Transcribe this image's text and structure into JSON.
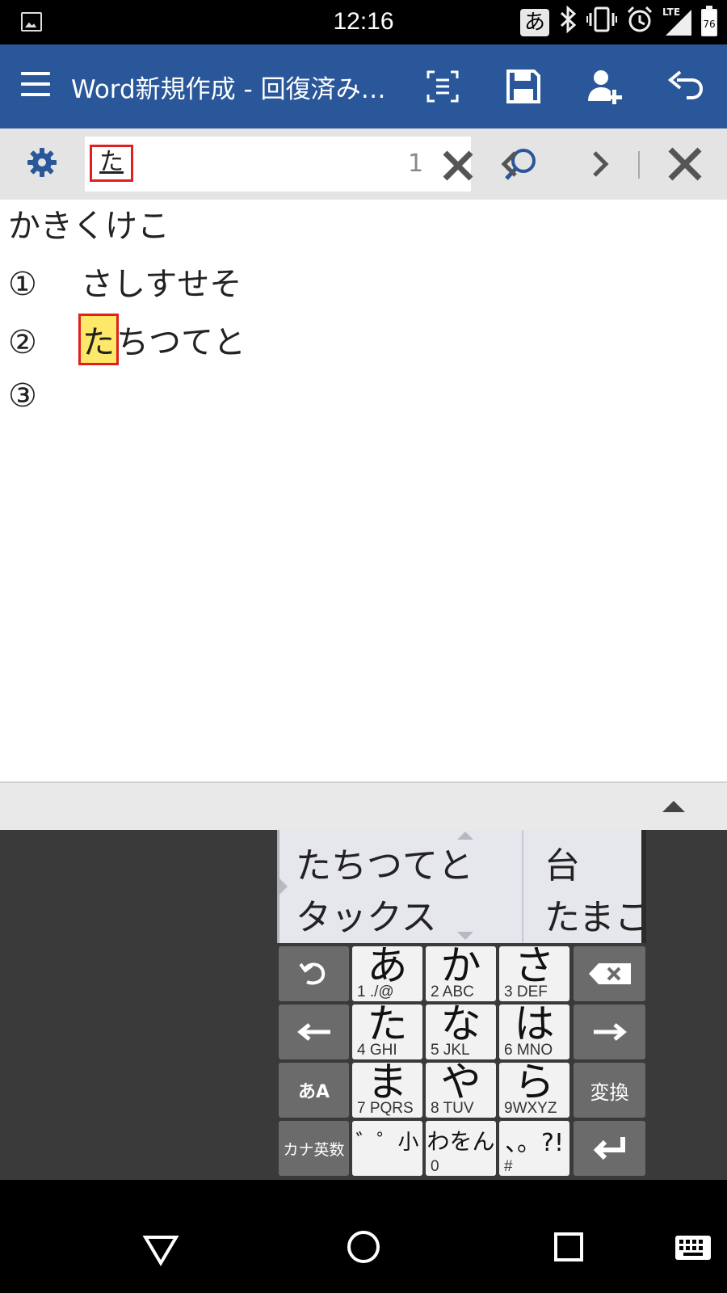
{
  "status_bar": {
    "time": "12:16",
    "ime_indicator": "あ",
    "network": "LTE",
    "battery": "76",
    "icons": [
      "image-icon",
      "bluetooth-icon",
      "vibrate-icon",
      "alarm-icon",
      "signal-icon",
      "battery-icon"
    ]
  },
  "app_bar": {
    "title": "Word新規作成 - 回復済み…",
    "color": "#2a579a",
    "icons": [
      "menu-icon",
      "focus-view-icon",
      "save-icon",
      "share-icon",
      "undo-icon"
    ]
  },
  "find_bar": {
    "query": "た",
    "match_count": "1",
    "icons": [
      "gear-icon",
      "clear-icon",
      "search-icon",
      "previous-icon",
      "next-icon",
      "close-icon"
    ]
  },
  "document": {
    "lines": [
      {
        "num": "",
        "text": "かきくけこ"
      },
      {
        "num": "①",
        "text": "さしすせそ"
      },
      {
        "num": "②",
        "highlight": "た",
        "text": "ちつてと"
      },
      {
        "num": "③",
        "text": ""
      }
    ],
    "highlight_color": "#fde86a"
  },
  "keyboard": {
    "candidates": [
      {
        "text": "たちつてと"
      },
      {
        "text": "台"
      },
      {
        "text": "タックス"
      },
      {
        "text": "たまこ"
      }
    ],
    "keys": [
      {
        "big": "あ",
        "small": "1 ./@"
      },
      {
        "big": "か",
        "small": "2 ABC"
      },
      {
        "big": "さ",
        "small": "3 DEF"
      },
      {
        "big": "た",
        "small": "4 GHI"
      },
      {
        "big": "な",
        "small": "5 JKL"
      },
      {
        "big": "は",
        "small": "6 MNO"
      },
      {
        "big": "ま",
        "small": "7 PQRS"
      },
      {
        "big": "や",
        "small": "8 TUV"
      },
      {
        "big": "ら",
        "small": "9WXYZ"
      },
      {
        "big": "わをん",
        "small": "0"
      },
      {
        "big": "、。?!",
        "small": "#"
      },
      {
        "big": "゛゜小",
        "small": ""
      }
    ],
    "mode_key": "あA",
    "kana_key": "カナ英数",
    "convert_key": "変換"
  }
}
